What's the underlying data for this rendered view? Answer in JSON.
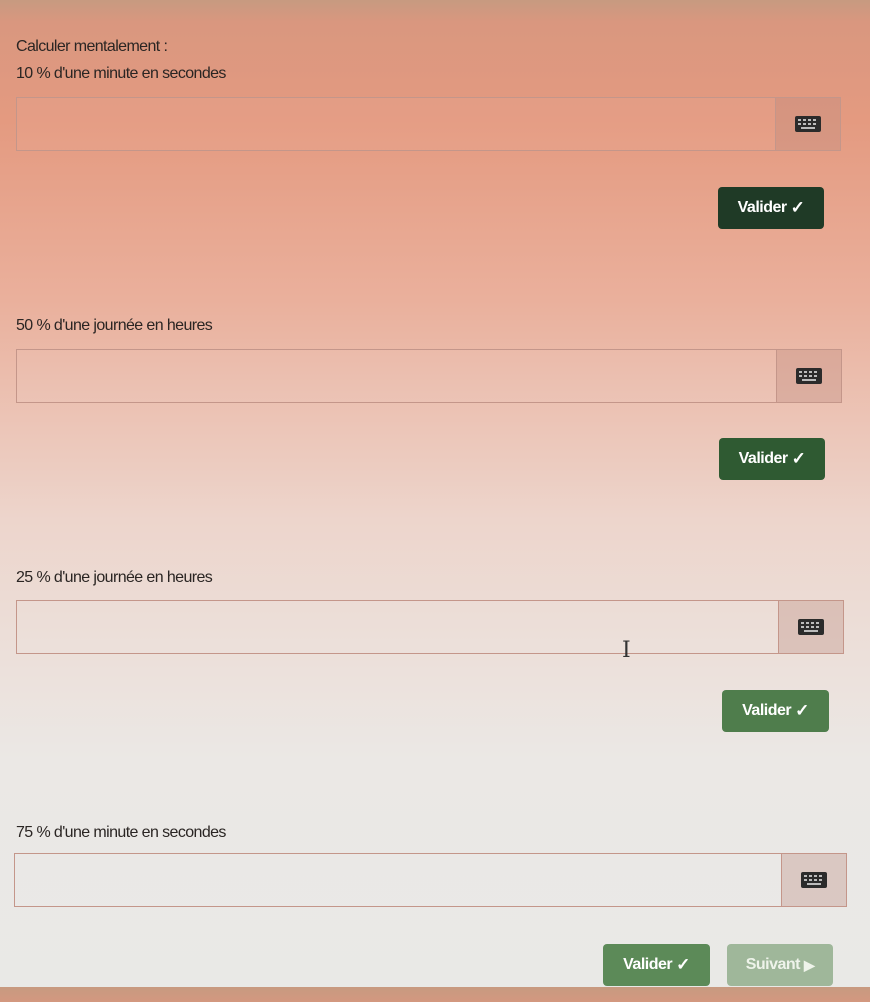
{
  "header": {
    "title": "Calculer mentalement :"
  },
  "questions": [
    {
      "label": "10 % d'une minute en secondes",
      "value": "",
      "validate_label": "Valider"
    },
    {
      "label": "50 % d'une journée en heures",
      "value": "",
      "validate_label": "Valider"
    },
    {
      "label": "25 % d'une journée en heures",
      "value": "",
      "validate_label": "Valider"
    },
    {
      "label": "75 % d'une minute en secondes",
      "value": "",
      "validate_label": "Valider"
    }
  ],
  "footer": {
    "next_label": "Suivant"
  },
  "icons": {
    "keyboard": "keyboard-icon",
    "check": "check-icon",
    "play": "play-icon",
    "text_cursor": "text-cursor-icon"
  },
  "colors": {
    "validate_dark": "#1f3a26",
    "validate_mid": "#2f5a32",
    "validate_light": "#4f7d4c",
    "next_disabled": "#9fb79a"
  }
}
